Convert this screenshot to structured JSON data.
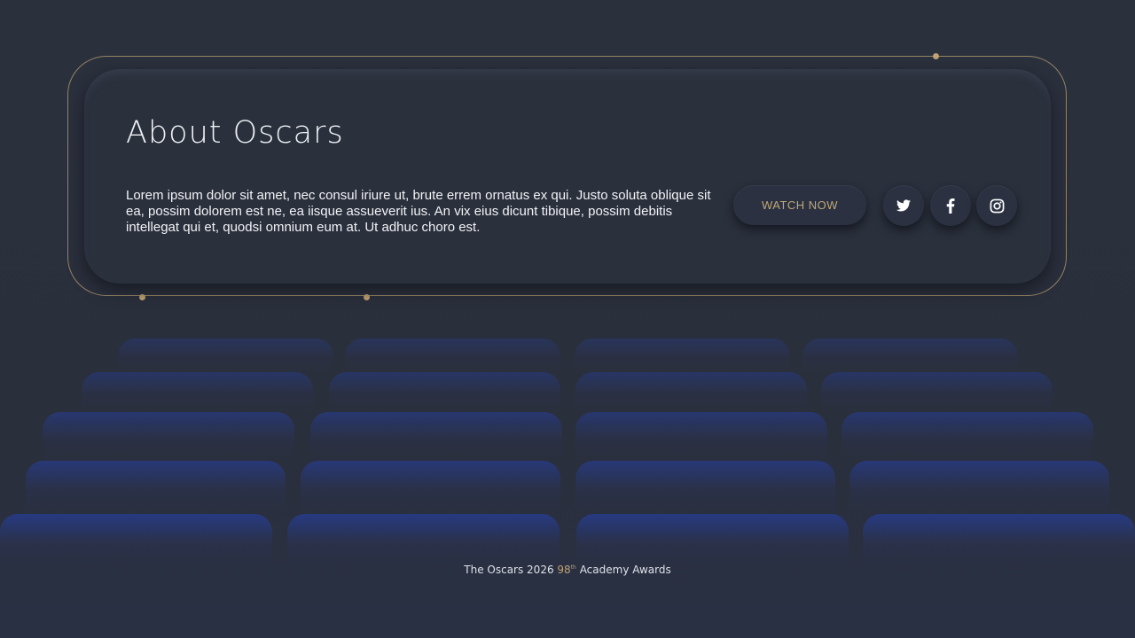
{
  "about": {
    "title": "About Oscars",
    "body": "Lorem ipsum dolor sit amet, nec consul iriure ut, brute errem ornatus ex qui. Justo soluta oblique sit ea, possim dolorem est ne, ea iisque assueverit ius. An vix eius dicunt tibique, possim debitis intellegat qui et, quodsi omnium eum at. Ut adhuc choro est.",
    "watch_label": "WATCH NOW",
    "social": [
      {
        "name": "twitter-icon"
      },
      {
        "name": "facebook-icon"
      },
      {
        "name": "instagram-icon"
      }
    ]
  },
  "footer": {
    "brand": "The Oscars 2026",
    "edition_number": "98",
    "edition_suffix": "th",
    "label": "Academy  Awards"
  },
  "colors": {
    "background": "#2a2f3c",
    "gold_accent": "#bfa174",
    "seat_blue": "#27377a",
    "text_light": "#eef0f4"
  }
}
